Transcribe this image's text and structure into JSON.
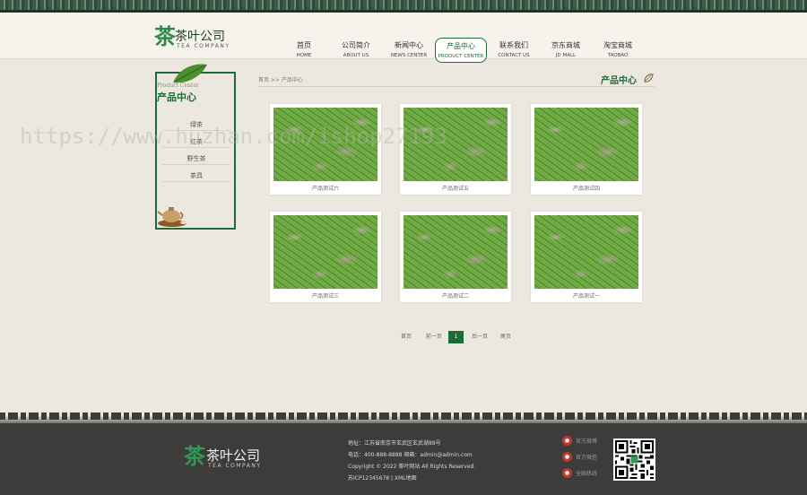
{
  "brand": {
    "char": "茶",
    "name": "茶叶公司",
    "en": "TEA COMPANY"
  },
  "nav": [
    {
      "cn": "首页",
      "en": "HOME",
      "active": false
    },
    {
      "cn": "公司简介",
      "en": "ABOUT US",
      "active": false
    },
    {
      "cn": "新闻中心",
      "en": "NEWS CENTER",
      "active": false
    },
    {
      "cn": "产品中心",
      "en": "PRODUCT CENTER",
      "active": true
    },
    {
      "cn": "联系我们",
      "en": "CONTACT US",
      "active": false
    },
    {
      "cn": "京东商城",
      "en": "JD MALL",
      "active": false
    },
    {
      "cn": "淘宝商城",
      "en": "TAOBAO",
      "active": false
    }
  ],
  "sidebar": {
    "en": "Product Center",
    "title": "产品中心",
    "items": [
      {
        "label": "绿茶"
      },
      {
        "label": "红茶"
      },
      {
        "label": "野生茶"
      },
      {
        "label": "茶具"
      }
    ]
  },
  "breadcrumb": "首页 >> 产品中心",
  "page_title": "产品中心",
  "products": [
    {
      "caption": "产品测试六"
    },
    {
      "caption": "产品测试五"
    },
    {
      "caption": "产品测试四"
    },
    {
      "caption": "产品测试三"
    },
    {
      "caption": "产品测试二"
    },
    {
      "caption": "产品测试一"
    }
  ],
  "pager": {
    "first": "首页",
    "prev": "前一页",
    "current": "1",
    "next": "后一页",
    "last": "尾页"
  },
  "footer": {
    "address": "地址：江苏省南京市玄武区玄武湖88号",
    "contact": "电话：400-888-8888    邮箱：admin@admin.com",
    "copyright": "Copyright © 2022 茶叶网站 All Rights Reserved.",
    "icp": "苏ICP12345678 | XML地图",
    "links": [
      {
        "label": "官方微博"
      },
      {
        "label": "官方微信"
      },
      {
        "label": "全国热线"
      }
    ]
  },
  "watermark": "https://www.huzhan.com/ishop27193",
  "colors": {
    "accent": "#1e6b3a",
    "footer_bg": "#3d3c3a",
    "page_bg": "#ece8df"
  }
}
